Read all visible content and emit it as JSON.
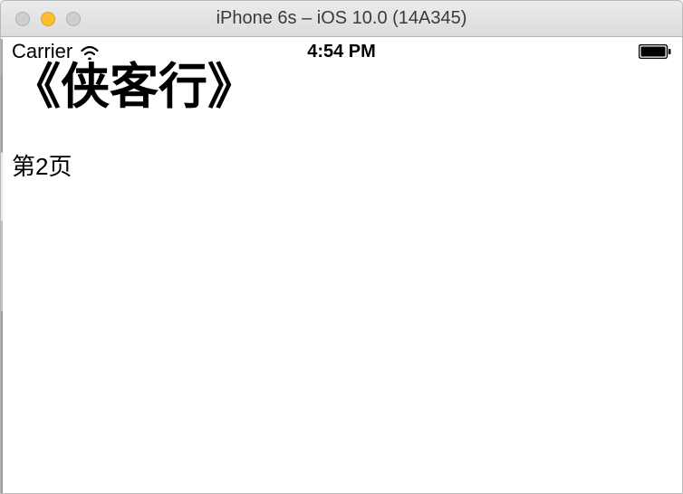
{
  "window": {
    "title": "iPhone 6s – iOS 10.0 (14A345)"
  },
  "statusBar": {
    "carrier": "Carrier",
    "time": "4:54 PM"
  },
  "content": {
    "title": "《侠客行》",
    "pageLabel": "第2页"
  }
}
